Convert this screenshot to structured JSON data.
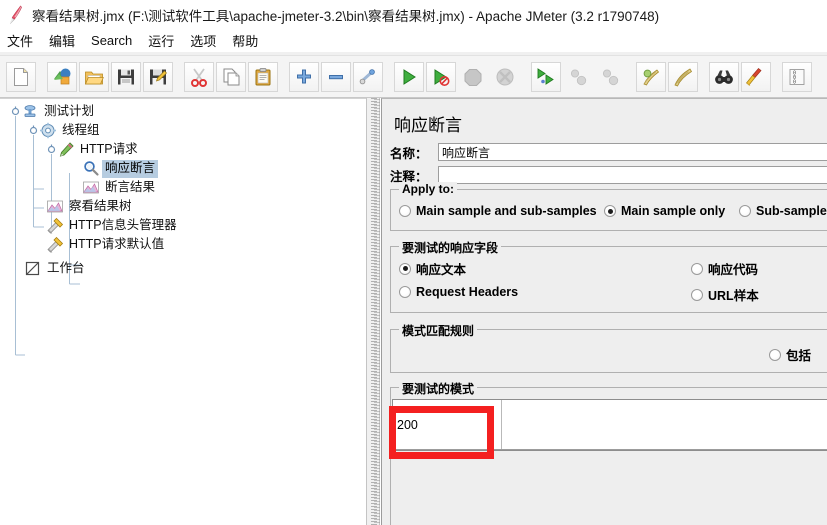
{
  "window": {
    "title": "察看结果树.jmx (F:\\测试软件工具\\apache-jmeter-3.2\\bin\\察看结果树.jmx) - Apache JMeter (3.2 r1790748)",
    "logo_icon": "jmeter-feather-icon"
  },
  "menubar": {
    "items": [
      {
        "label": "文件",
        "name": "menu-file"
      },
      {
        "label": "编辑",
        "name": "menu-edit"
      },
      {
        "label": "Search",
        "name": "menu-search"
      },
      {
        "label": "运行",
        "name": "menu-run"
      },
      {
        "label": "选项",
        "name": "menu-options"
      },
      {
        "label": "帮助",
        "name": "menu-help"
      }
    ]
  },
  "toolbar": {
    "buttons": [
      {
        "icon": "new-document-icon",
        "name": "toolbar-new",
        "enabled": true
      },
      {
        "icon": "templates-icon",
        "name": "toolbar-templates",
        "enabled": true
      },
      {
        "icon": "open-folder-icon",
        "name": "toolbar-open",
        "enabled": true
      },
      {
        "icon": "save-floppy-icon",
        "name": "toolbar-save",
        "enabled": true
      },
      {
        "icon": "save-as-icon",
        "name": "toolbar-save-as",
        "enabled": true
      },
      {
        "icon": "cut-scissors-icon",
        "name": "toolbar-cut",
        "enabled": true
      },
      {
        "icon": "copy-icon",
        "name": "toolbar-copy",
        "enabled": true
      },
      {
        "icon": "paste-clipboard-icon",
        "name": "toolbar-paste",
        "enabled": true
      },
      {
        "icon": "expand-plus-icon",
        "name": "toolbar-expand-all",
        "enabled": true
      },
      {
        "icon": "collapse-minus-icon",
        "name": "toolbar-collapse-all",
        "enabled": true
      },
      {
        "icon": "toggle-icon",
        "name": "toolbar-toggle",
        "enabled": true
      },
      {
        "icon": "start-play-icon",
        "name": "toolbar-start",
        "enabled": true
      },
      {
        "icon": "start-no-pause-icon",
        "name": "toolbar-start-no-timers",
        "enabled": true
      },
      {
        "icon": "stop-icon",
        "name": "toolbar-stop",
        "enabled": false
      },
      {
        "icon": "shutdown-icon",
        "name": "toolbar-shutdown",
        "enabled": false
      },
      {
        "icon": "remote-start-icon",
        "name": "toolbar-remote-start-all",
        "enabled": true
      },
      {
        "icon": "remote-stop-icon",
        "name": "toolbar-remote-stop-all",
        "enabled": false
      },
      {
        "icon": "remote-shutdown-icon",
        "name": "toolbar-remote-shutdown",
        "enabled": false
      },
      {
        "icon": "clear-icon",
        "name": "toolbar-clear",
        "enabled": true
      },
      {
        "icon": "clear-all-icon",
        "name": "toolbar-clear-all",
        "enabled": true
      },
      {
        "icon": "search-binoculars-icon",
        "name": "toolbar-search",
        "enabled": true
      },
      {
        "icon": "reset-search-broom-icon",
        "name": "toolbar-reset-search",
        "enabled": true
      },
      {
        "icon": "function-helper-icon",
        "name": "toolbar-function-helper",
        "enabled": true
      }
    ]
  },
  "tree": {
    "nodes": [
      {
        "label": "测试计划",
        "icon": "test-plan-icon",
        "depth": 0,
        "selected": false,
        "expanded": true
      },
      {
        "label": "线程组",
        "icon": "thread-group-icon",
        "depth": 1,
        "selected": false,
        "expanded": true
      },
      {
        "label": "HTTP请求",
        "icon": "http-sampler-icon",
        "depth": 2,
        "selected": false,
        "expanded": true
      },
      {
        "label": "响应断言",
        "icon": "assertion-icon",
        "depth": 3,
        "selected": true,
        "expanded": false
      },
      {
        "label": "断言结果",
        "icon": "assertion-results-icon",
        "depth": 3,
        "selected": false,
        "expanded": false
      },
      {
        "label": "察看结果树",
        "icon": "view-results-tree-icon",
        "depth": 2,
        "selected": false,
        "expanded": false
      },
      {
        "label": "HTTP信息头管理器",
        "icon": "header-manager-icon",
        "depth": 2,
        "selected": false,
        "expanded": false
      },
      {
        "label": "HTTP请求默认值",
        "icon": "http-defaults-icon",
        "depth": 2,
        "selected": false,
        "expanded": false
      },
      {
        "label": "工作台",
        "icon": "workbench-icon",
        "depth": 0,
        "selected": false,
        "expanded": false
      }
    ]
  },
  "panel": {
    "title": "响应断言",
    "name_label": "名称：",
    "name_value": "响应断言",
    "comment_label": "注释：",
    "comment_value": "",
    "apply_to": {
      "group_title": "Apply to:",
      "options": [
        {
          "label": "Main sample and sub-samples",
          "selected": false,
          "name": "radio-main-and-sub"
        },
        {
          "label": "Main sample only",
          "selected": true,
          "name": "radio-main-only"
        },
        {
          "label": "Sub-samples",
          "selected": false,
          "name": "radio-sub-samples"
        }
      ]
    },
    "response_field": {
      "group_title": "要测试的响应字段",
      "options": [
        {
          "label": "响应文本",
          "selected": true,
          "name": "radio-response-text"
        },
        {
          "label": "响应代码",
          "selected": false,
          "name": "radio-response-code"
        },
        {
          "label": "Request Headers",
          "selected": false,
          "name": "radio-request-headers"
        },
        {
          "label": "URL样本",
          "selected": false,
          "name": "radio-url-sample"
        }
      ]
    },
    "pattern_rules": {
      "group_title": "模式匹配规则",
      "options": [
        {
          "label": "包括",
          "selected": false,
          "name": "radio-contains"
        }
      ]
    },
    "patterns_to_test": {
      "group_title": "要测试的模式",
      "rows": [
        {
          "value": "200"
        }
      ]
    }
  },
  "annotation": {
    "red_highlight": {
      "name": "red-highlight-box",
      "color": "#f42020",
      "targets": "patterns-to-test-first-cell"
    }
  }
}
